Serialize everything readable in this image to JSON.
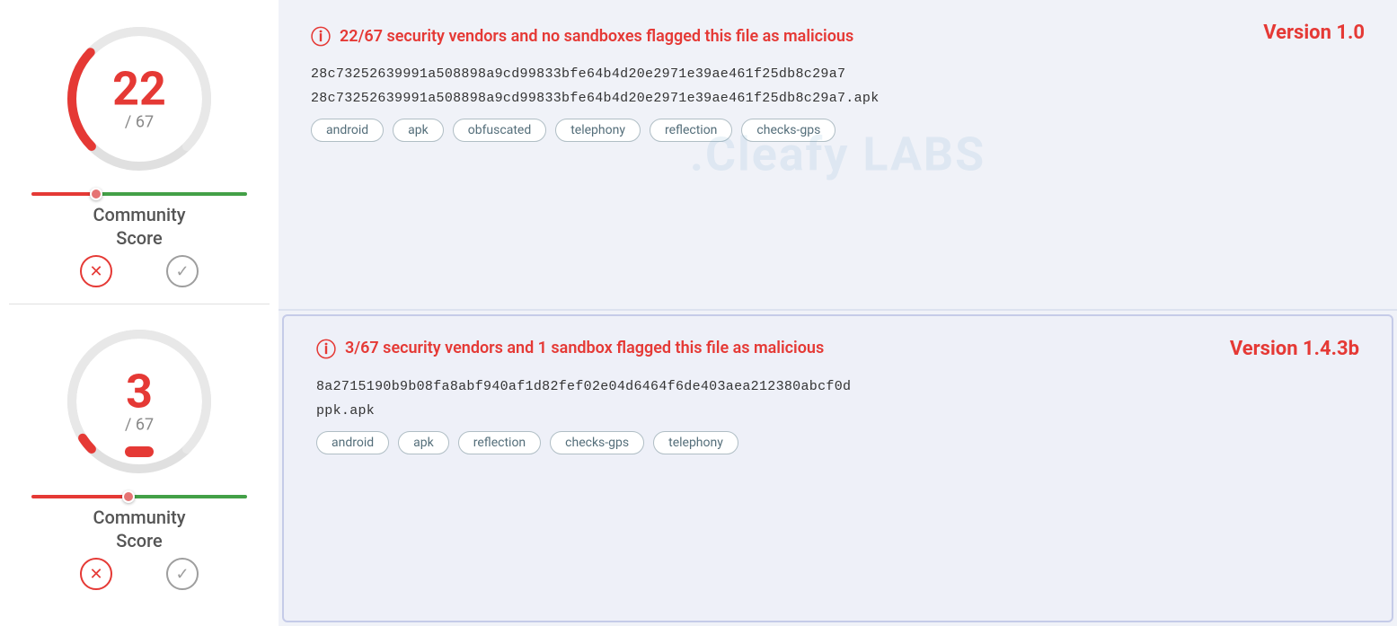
{
  "version1": {
    "score": "22",
    "denom": "/ 67",
    "alert": "22/67 security vendors and no sandboxes flagged this file as malicious",
    "hash1": "28c73252639991a508898a9cd99833bfe64b4d20e2971e39ae461f25db8c29a7",
    "hash2": "28c73252639991a508898a9cd99833bfe64b4d20e2971e39ae461f25db8c29a7.apk",
    "tags": [
      "android",
      "apk",
      "obfuscated",
      "telephony",
      "reflection",
      "checks-gps"
    ],
    "version_label": "Version 1.0",
    "community_label": "Community\nScore",
    "slider_pct": 30,
    "negative_btn": "✕",
    "positive_btn": "✓"
  },
  "version2": {
    "score": "3",
    "denom": "/ 67",
    "alert": "3/67 security vendors and 1 sandbox flagged this file as malicious",
    "hash1": "8a2715190b9b08fa8abf940af1d82fef02e04d6464f6de403aea212380abcf0d",
    "hash2": "ppk.apk",
    "tags": [
      "android",
      "apk",
      "reflection",
      "checks-gps",
      "telephony"
    ],
    "version_label": "Version 1.4.3b",
    "community_label": "Community\nScore",
    "slider_pct": 45,
    "negative_btn": "✕",
    "positive_btn": "✓"
  },
  "watermark": ".Cleafy   LABS"
}
